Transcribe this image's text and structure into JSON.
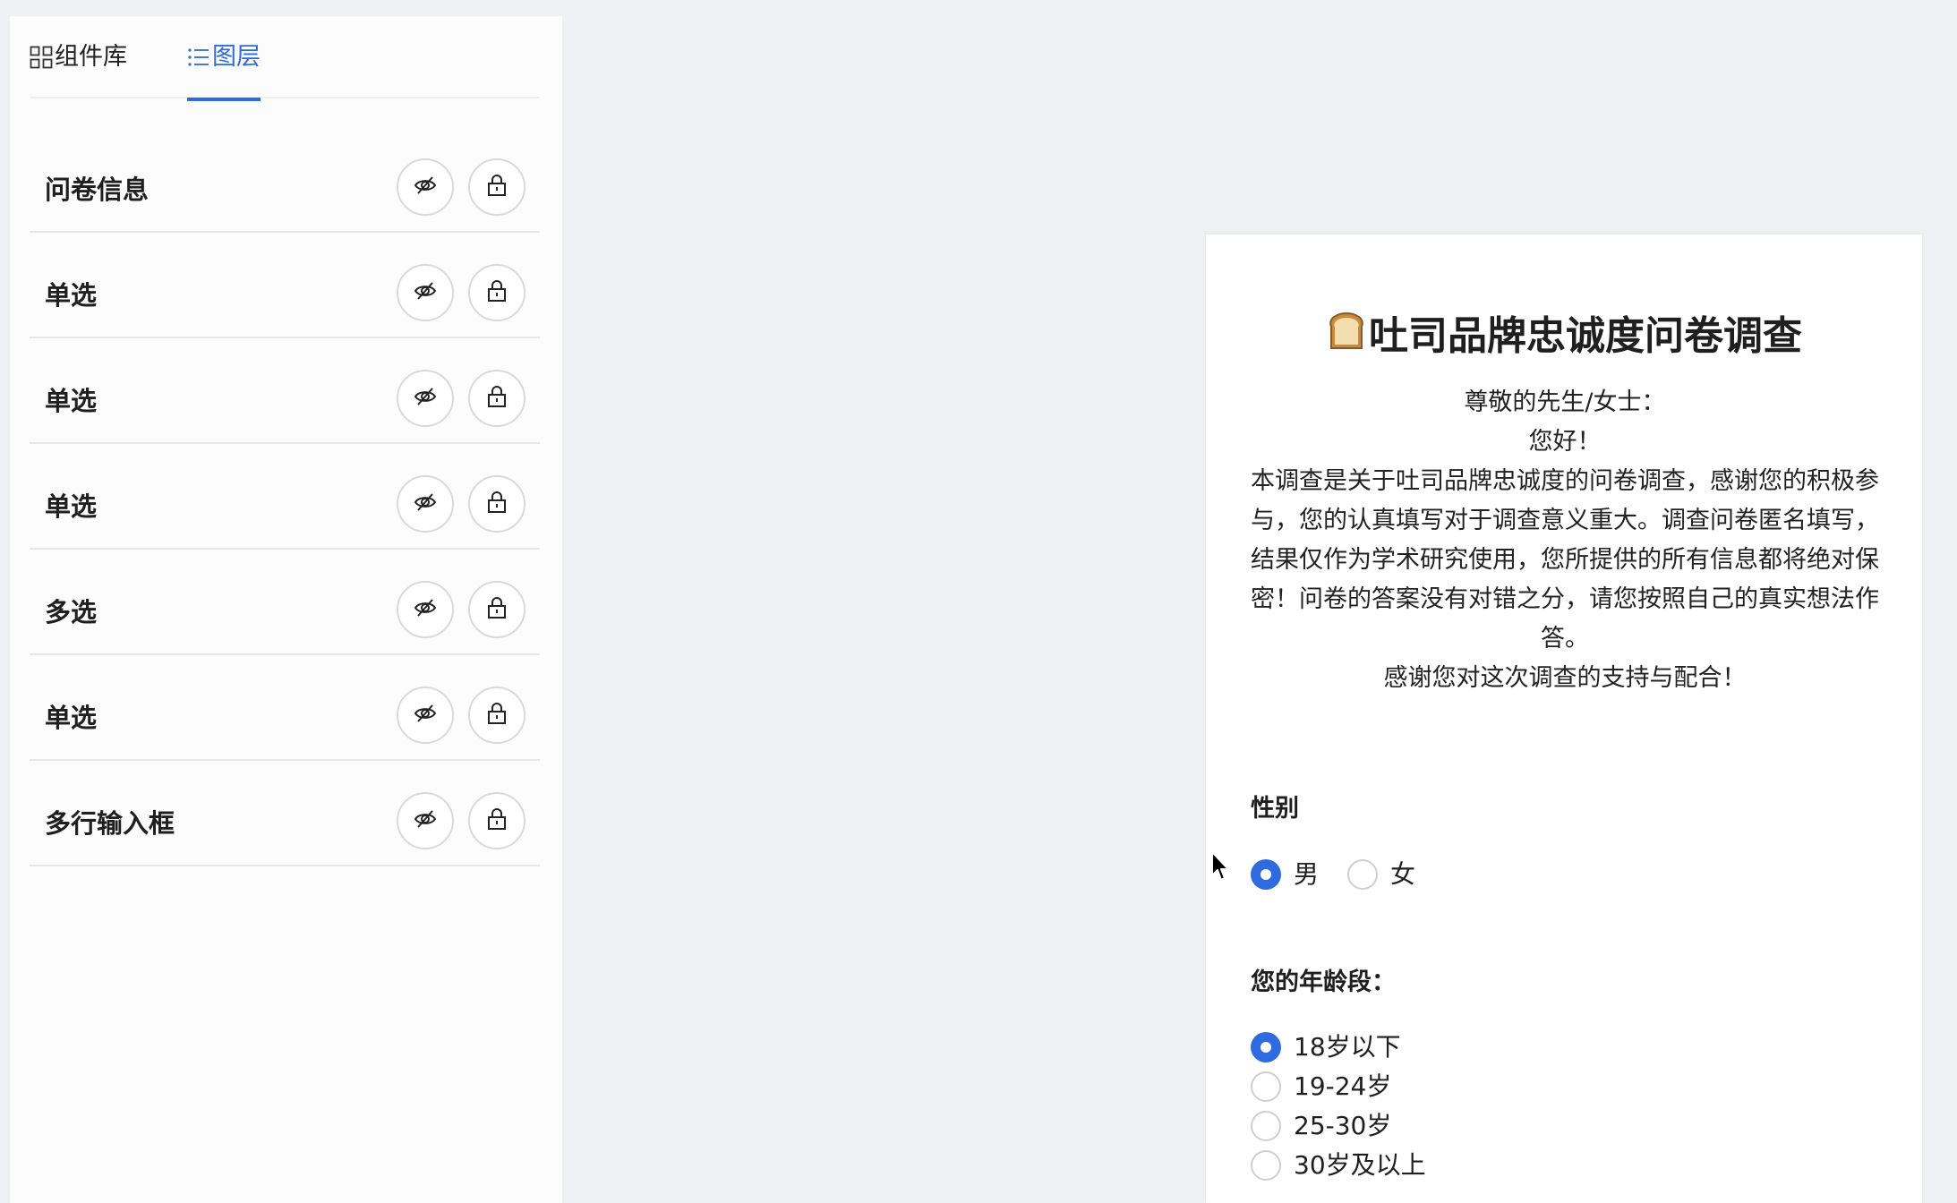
{
  "tabs": {
    "components_icon": "grid-icon",
    "components_label": "组件库",
    "layers_icon": "list-icon",
    "layers_label": "图层",
    "active": "layers"
  },
  "layers": [
    {
      "label": "问卷信息"
    },
    {
      "label": "单选"
    },
    {
      "label": "单选"
    },
    {
      "label": "单选"
    },
    {
      "label": "多选"
    },
    {
      "label": "单选"
    },
    {
      "label": "多行输入框"
    }
  ],
  "survey": {
    "title": "吐司品牌忠诚度问卷调查",
    "title_icon": "bread-icon",
    "greeting": "尊敬的先生/女士：",
    "hello": "您好！",
    "body": "本调查是关于吐司品牌忠诚度的问卷调查，感谢您的积极参与，您的认真填写对于调查意义重大。调查问卷匿名填写，结果仅作为学术研究使用，您所提供的所有信息都将绝对保密！问卷的答案没有对错之分，请您按照自己的真实想法作答。",
    "thanks": "感谢您对这次调查的支持与配合！",
    "questions": [
      {
        "title": "性别",
        "options": [
          {
            "label": "男",
            "checked": true
          },
          {
            "label": "女",
            "checked": false
          }
        ]
      },
      {
        "title": "您的年龄段：",
        "options": [
          {
            "label": "18岁以下",
            "checked": true
          },
          {
            "label": "19-24岁",
            "checked": false
          },
          {
            "label": "25-30岁",
            "checked": false
          },
          {
            "label": "30岁及以上",
            "checked": false
          }
        ]
      }
    ]
  },
  "colors": {
    "accent": "#2f6bdf",
    "canvas_bg": "#eef0f3",
    "panel_bg": "#fcfcfc"
  }
}
